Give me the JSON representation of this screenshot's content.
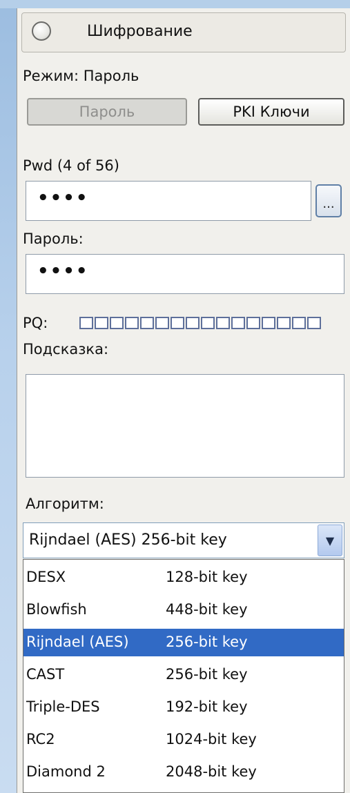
{
  "header": {
    "title": "Шифрование"
  },
  "mode": {
    "label": "Режим: Пароль"
  },
  "mode_buttons": {
    "password": "Пароль",
    "pki": "PKI Ключи"
  },
  "pwd": {
    "label": "Pwd (4 of 56)",
    "value": "••••",
    "browse_label": "..."
  },
  "password_confirm": {
    "label": "Пароль:",
    "value": "••••"
  },
  "pq": {
    "label": "PQ:",
    "squares": 16,
    "filled": 0
  },
  "hint": {
    "label": "Подсказка:",
    "value": ""
  },
  "algorithm": {
    "label": "Алгоритм:",
    "selected": "Rijndael (AES) 256-bit key",
    "options": [
      {
        "name": "DESX",
        "bits": "128-bit key"
      },
      {
        "name": "Blowfish",
        "bits": "448-bit key"
      },
      {
        "name": "Rijndael (AES)",
        "bits": "256-bit key"
      },
      {
        "name": "CAST",
        "bits": "256-bit key"
      },
      {
        "name": "Triple-DES",
        "bits": "192-bit key"
      },
      {
        "name": "RC2",
        "bits": "1024-bit key"
      },
      {
        "name": "Diamond 2",
        "bits": "2048-bit key"
      }
    ],
    "highlighted_index": 2
  },
  "colors": {
    "selection": "#316ac5",
    "panel": "#f1f0ec",
    "desktop": "#b8d1ec"
  }
}
